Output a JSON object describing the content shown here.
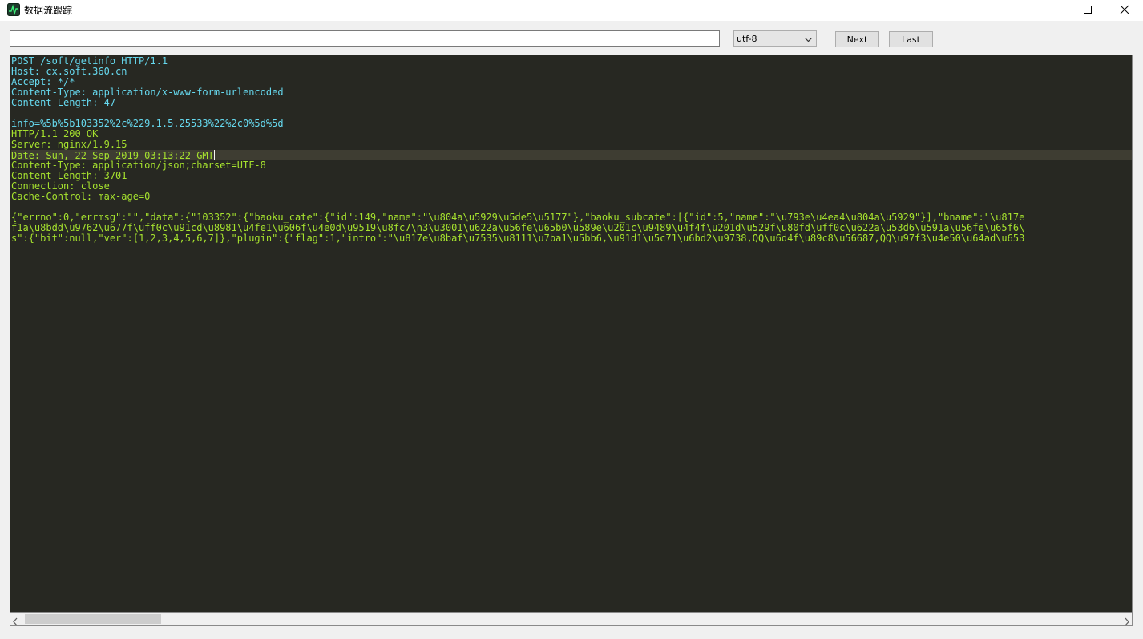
{
  "window": {
    "title": "数据流跟踪",
    "controls": {
      "minimize_icon": "minimize-icon",
      "maximize_icon": "maximize-icon",
      "close_icon": "close-icon"
    }
  },
  "toolbar": {
    "search_value": "",
    "encoding": {
      "selected": "utf-8",
      "icon": "chevron-down-icon"
    },
    "next_label": "Next",
    "last_label": "Last"
  },
  "colors": {
    "request_text": "#66d9ef",
    "response_text": "#a6e22e",
    "editor_background": "#272822"
  },
  "stream": {
    "lines": [
      {
        "text": "POST /soft/getinfo HTTP/1.1",
        "kind": "request"
      },
      {
        "text": "Host: cx.soft.360.cn",
        "kind": "request"
      },
      {
        "text": "Accept: */*",
        "kind": "request"
      },
      {
        "text": "Content-Type: application/x-www-form-urlencoded",
        "kind": "request"
      },
      {
        "text": "Content-Length: 47",
        "kind": "request"
      },
      {
        "text": "",
        "kind": "request"
      },
      {
        "text": "info=%5b%5b103352%2c%229.1.5.25533%22%2c0%5d%5d",
        "kind": "request"
      },
      {
        "text": "HTTP/1.1 200 OK",
        "kind": "response"
      },
      {
        "text": "Server: nginx/1.9.15",
        "kind": "response"
      },
      {
        "text": "Date: Sun, 22 Sep 2019 03:13:22 GMT",
        "kind": "response",
        "current": true
      },
      {
        "text": "Content-Type: application/json;charset=UTF-8",
        "kind": "response"
      },
      {
        "text": "Content-Length: 3701",
        "kind": "response"
      },
      {
        "text": "Connection: close",
        "kind": "response"
      },
      {
        "text": "Cache-Control: max-age=0",
        "kind": "response"
      },
      {
        "text": "",
        "kind": "response"
      },
      {
        "text": "{\"errno\":0,\"errmsg\":\"\",\"data\":{\"103352\":{\"baoku_cate\":{\"id\":149,\"name\":\"\\u804a\\u5929\\u5de5\\u5177\"},\"baoku_subcate\":[{\"id\":5,\"name\":\"\\u793e\\u4ea4\\u804a\\u5929\"}],\"bname\":\"\\u817e",
        "kind": "response"
      },
      {
        "text": "f1a\\u8bdd\\u9762\\u677f\\uff0c\\u91cd\\u8981\\u4fe1\\u606f\\u4e0d\\u9519\\u8fc7\\n3\\u3001\\u622a\\u56fe\\u65b0\\u589e\\u201c\\u9489\\u4f4f\\u201d\\u529f\\u80fd\\uff0c\\u622a\\u53d6\\u591a\\u56fe\\u65f6\\",
        "kind": "response"
      },
      {
        "text": "s\":{\"bit\":null,\"ver\":[1,2,3,4,5,6,7]},\"plugin\":{\"flag\":1,\"intro\":\"\\u817e\\u8baf\\u7535\\u8111\\u7ba1\\u5bb6,\\u91d1\\u5c71\\u6bd2\\u9738,QQ\\u6d4f\\u89c8\\u56687,QQ\\u97f3\\u4e50\\u64ad\\u653",
        "kind": "response"
      }
    ]
  },
  "scrollbar": {
    "left_icon": "chevron-left-icon",
    "right_icon": "chevron-right-icon",
    "position": 0.0
  }
}
